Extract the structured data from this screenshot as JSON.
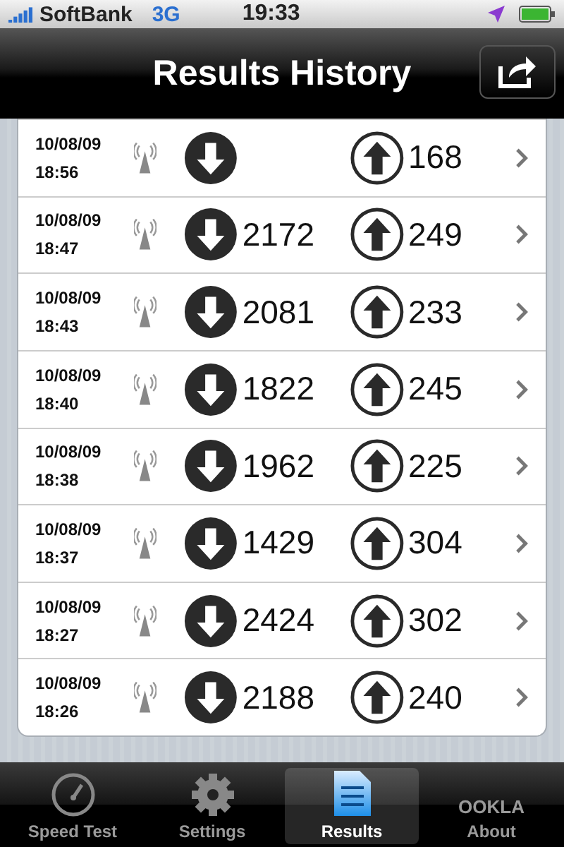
{
  "status_bar": {
    "carrier": "SoftBank",
    "network": "3G",
    "time": "19:33"
  },
  "nav": {
    "title": "Results History"
  },
  "results": [
    {
      "date": "10/08/09",
      "time": "18:56",
      "upload": "168"
    },
    {
      "date": "10/08/09",
      "time": "18:47",
      "download": "2172",
      "upload": "249"
    },
    {
      "date": "10/08/09",
      "time": "18:43",
      "download": "2081",
      "upload": "233"
    },
    {
      "date": "10/08/09",
      "time": "18:40",
      "download": "1822",
      "upload": "245"
    },
    {
      "date": "10/08/09",
      "time": "18:38",
      "download": "1962",
      "upload": "225"
    },
    {
      "date": "10/08/09",
      "time": "18:37",
      "download": "1429",
      "upload": "304"
    },
    {
      "date": "10/08/09",
      "time": "18:27",
      "download": "2424",
      "upload": "302"
    },
    {
      "date": "10/08/09",
      "time": "18:26",
      "download": "2188",
      "upload": "240"
    }
  ],
  "tabs": [
    {
      "kind": "gauge",
      "label": "Speed Test",
      "selected": false
    },
    {
      "kind": "gear",
      "label": "Settings",
      "selected": false
    },
    {
      "kind": "doc",
      "label": "Results",
      "selected": true
    },
    {
      "kind": "logo",
      "label": "About",
      "logo": "OOKLA",
      "selected": false
    }
  ]
}
